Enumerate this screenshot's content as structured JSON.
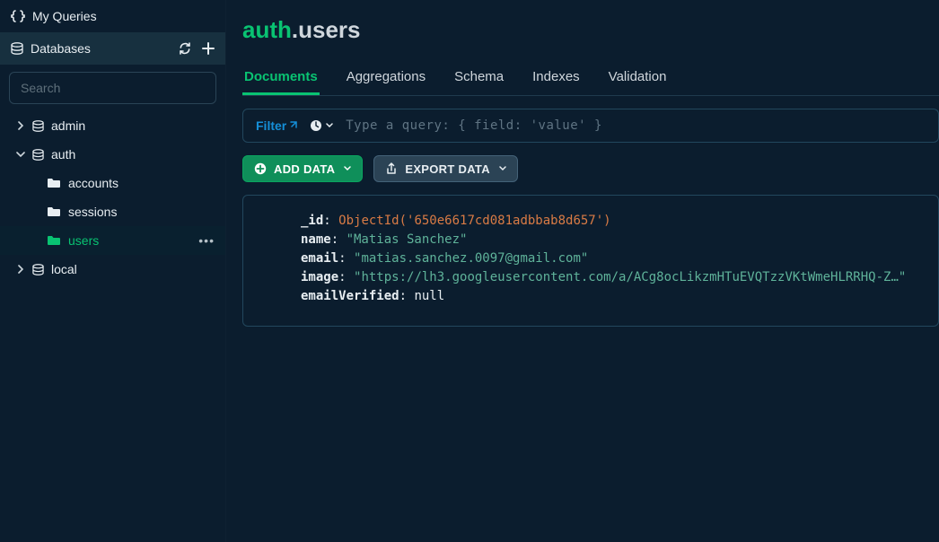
{
  "sidebar": {
    "my_queries_label": "My Queries",
    "databases_label": "Databases",
    "search_placeholder": "Search",
    "tree": {
      "admin": "admin",
      "auth": "auth",
      "auth_children": {
        "accounts": "accounts",
        "sessions": "sessions",
        "users": "users"
      },
      "local": "local"
    }
  },
  "breadcrumb": {
    "db": "auth",
    "separator": ".",
    "coll": "users"
  },
  "tabs": {
    "documents": "Documents",
    "aggregations": "Aggregations",
    "schema": "Schema",
    "indexes": "Indexes",
    "validation": "Validation"
  },
  "filter": {
    "label": "Filter",
    "placeholder": "Type a query: { field: 'value' }"
  },
  "buttons": {
    "add_data": "ADD DATA",
    "export_data": "EXPORT DATA"
  },
  "document": {
    "id_key": "_id",
    "id_val": "ObjectId('650e6617cd081adbbab8d657')",
    "name_key": "name",
    "name_val": "\"Matias Sanchez\"",
    "email_key": "email",
    "email_val": "\"matias.sanchez.0097@gmail.com\"",
    "image_key": "image",
    "image_val": "\"https://lh3.googleusercontent.com/a/ACg8ocLikzmHTuEVQTzzVKtWmeHLRRHQ-Z…\"",
    "ev_key": "emailVerified",
    "ev_val": "null"
  }
}
